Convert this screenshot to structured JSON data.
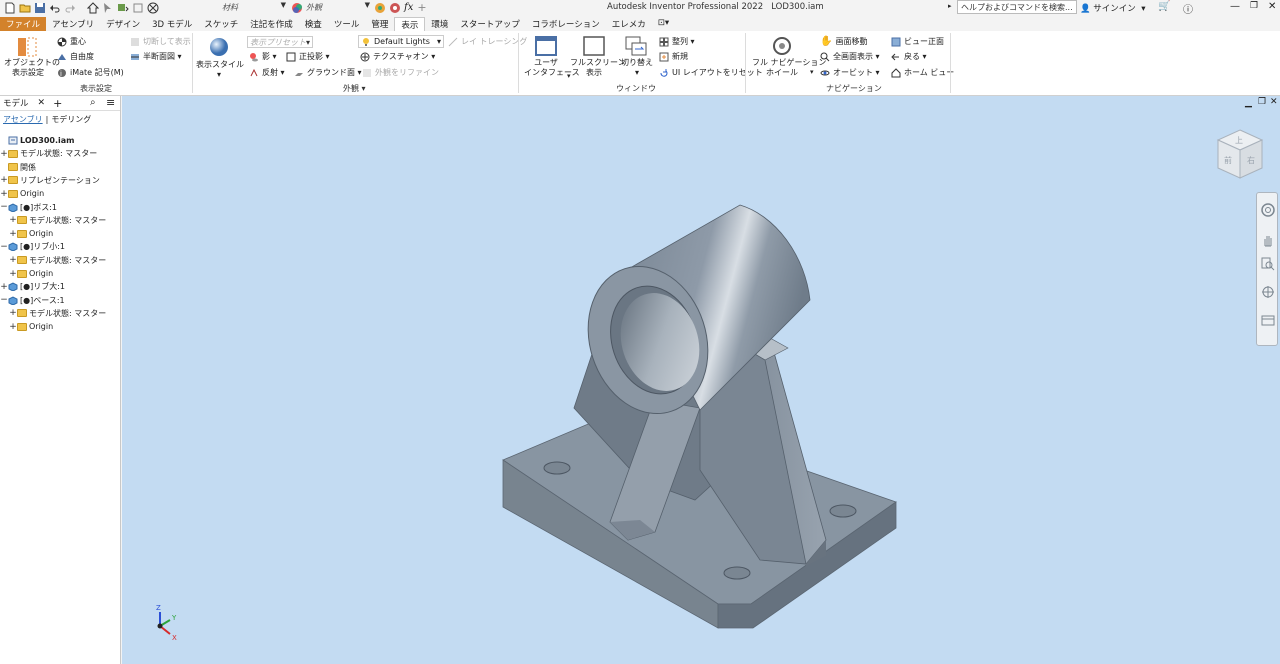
{
  "app": {
    "title": "Autodesk Inventor Professional 2022",
    "document": "LOD300.iam"
  },
  "quick_access": {
    "material_value": "材料",
    "appearance_value": "外観",
    "icons": [
      "new-icon",
      "open-icon",
      "save-icon",
      "undo-icon",
      "redo-icon",
      "home-icon",
      "select-icon",
      "update-icon",
      "properties-icon",
      "material-icon",
      "appearance-icon",
      "adjust-icon",
      "clear-icon",
      "fx-icon",
      "add-icon"
    ]
  },
  "help_search": {
    "placeholder": "ヘルプおよびコマンドを検索..."
  },
  "signin": "サインイン",
  "tabs": [
    "ファイル",
    "アセンブリ",
    "デザイン",
    "3D モデル",
    "スケッチ",
    "注記を作成",
    "検査",
    "ツール",
    "管理",
    "表示",
    "環境",
    "スタートアップ",
    "コラボレーション",
    "エレメカ"
  ],
  "active_tab": "表示",
  "ribbon": {
    "display_settings": {
      "object_display": "オブジェクトの\n表示設定",
      "center_of_gravity": "重心",
      "dof": "自由度",
      "imate": "iMate 記号(M)",
      "cut_display": "切断して表示",
      "half_section": "半断面図",
      "group_label": "表示設定"
    },
    "appearance": {
      "visual_style": "表示スタイル",
      "preset": "表示プリセット",
      "shadow": "影",
      "reflection": "反射",
      "orthographic": "正投影",
      "ground_plane": "グラウンド面",
      "lighting": "Default Lights",
      "ray_tracing": "レイ トレーシング",
      "texture_on": "テクスチャオン",
      "refine_appearance": "外観をリファイン",
      "group_label": "外観"
    },
    "window": {
      "user_interface": "ユーザ\nインタフェース",
      "fullscreen": "フルスクリーン\n表示",
      "switch": "切り替え",
      "arrange": "整列",
      "new": "新規",
      "reset_layout": "UI レイアウトをリセット",
      "group_label": "ウィンドウ"
    },
    "navigation": {
      "full_wheel": "フル ナビゲーション\nホイール",
      "pan": "画面移動",
      "zoom_all": "全画面表示",
      "orbit": "オービット",
      "look_at": "ビュー正面",
      "back": "戻る",
      "home_view": "ホーム ビュー",
      "group_label": "ナビゲーション"
    }
  },
  "browser": {
    "tab_label": "モデル",
    "sub_tabs": [
      "アセンブリ",
      "モデリング"
    ],
    "tree": [
      {
        "label": "LOD300.iam",
        "level": 0,
        "exp": "",
        "icon": "assembly"
      },
      {
        "label": "モデル状態: マスター",
        "level": 1,
        "exp": "+",
        "icon": "folder"
      },
      {
        "label": "関係",
        "level": 1,
        "exp": "",
        "icon": "folder"
      },
      {
        "label": "リプレゼンテーション",
        "level": 1,
        "exp": "+",
        "icon": "folder"
      },
      {
        "label": "Origin",
        "level": 1,
        "exp": "+",
        "icon": "folder"
      },
      {
        "label": "[●]ボス:1",
        "level": 1,
        "exp": "−",
        "icon": "part"
      },
      {
        "label": "モデル状態: マスター",
        "level": 2,
        "exp": "+",
        "icon": "folder"
      },
      {
        "label": "Origin",
        "level": 2,
        "exp": "+",
        "icon": "folder"
      },
      {
        "label": "[●]リブ小:1",
        "level": 1,
        "exp": "−",
        "icon": "part"
      },
      {
        "label": "モデル状態: マスター",
        "level": 2,
        "exp": "+",
        "icon": "folder"
      },
      {
        "label": "Origin",
        "level": 2,
        "exp": "+",
        "icon": "folder"
      },
      {
        "label": "[●]リブ大:1",
        "level": 1,
        "exp": "+",
        "icon": "part"
      },
      {
        "label": "[●]ベース:1",
        "level": 1,
        "exp": "−",
        "icon": "part"
      },
      {
        "label": "モデル状態: マスター",
        "level": 2,
        "exp": "+",
        "icon": "folder"
      },
      {
        "label": "Origin",
        "level": 2,
        "exp": "+",
        "icon": "folder"
      }
    ]
  },
  "viewcube": {
    "faces": [
      "前",
      "右",
      "上"
    ]
  },
  "triad": {
    "x": "X",
    "y": "Y",
    "z": "Z"
  },
  "colors": {
    "file_tab": "#d3822b",
    "viewport_bg": "#c3dbf2",
    "model_body": "#7d8a98"
  }
}
